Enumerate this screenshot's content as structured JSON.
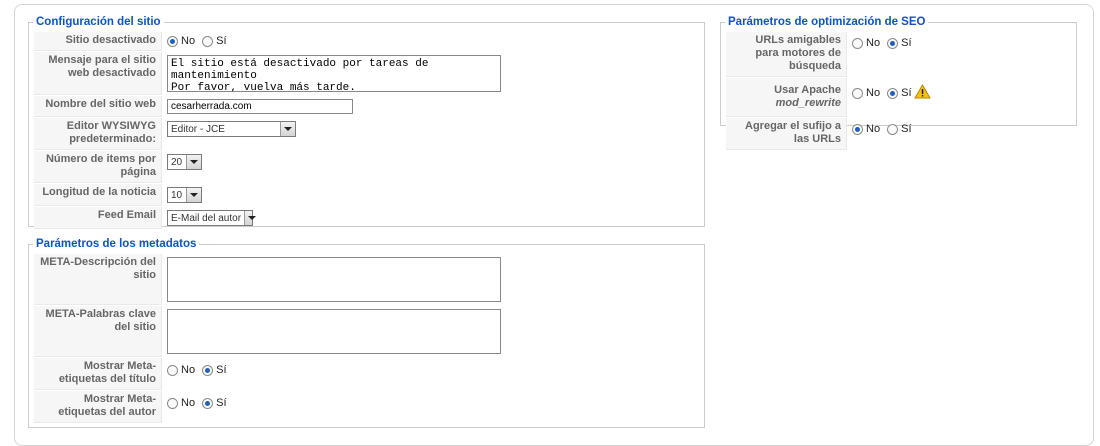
{
  "site": {
    "legend": "Configuración del sitio",
    "offline": {
      "label": "Sitio desactivado",
      "options": [
        "No",
        "Sí"
      ],
      "selected": "No"
    },
    "offline_message": {
      "label": "Mensaje para el sitio web desactivado",
      "value": "El sitio está desactivado por tareas de mantenimiento\nPor favor, vuelva más tarde."
    },
    "site_name": {
      "label": "Nombre del sitio web",
      "value": "cesarherrada.com"
    },
    "editor": {
      "label": "Editor WYSIWYG predeterminado:",
      "value": "Editor - JCE"
    },
    "list_limit": {
      "label": "Número de items por página",
      "value": "20"
    },
    "feed_limit": {
      "label": "Longitud de la noticia",
      "value": "10"
    },
    "feed_email": {
      "label": "Feed Email",
      "value": "E-Mail del autor"
    }
  },
  "metadata": {
    "legend": "Parámetros de los metadatos",
    "meta_desc": {
      "label": "META-Descripción del sitio",
      "value": ""
    },
    "meta_keys": {
      "label": "META-Palabras clave del sitio",
      "value": ""
    },
    "meta_title": {
      "label": "Mostrar Meta-etiquetas del título",
      "options": [
        "No",
        "Sí"
      ],
      "selected": "Sí"
    },
    "meta_author": {
      "label": "Mostrar Meta-etiquetas del autor",
      "options": [
        "No",
        "Sí"
      ],
      "selected": "Sí"
    }
  },
  "seo": {
    "legend": "Parámetros de optimización de SEO",
    "sef": {
      "label": "URLs amigables para motores de búsqueda",
      "options": [
        "No",
        "Sí"
      ],
      "selected": "Sí"
    },
    "rewrite": {
      "label_prefix": "Usar Apache ",
      "label_em": "mod_rewrite",
      "options": [
        "No",
        "Sí"
      ],
      "selected": "Sí",
      "icon": "warning-icon"
    },
    "suffix": {
      "label": "Agregar el sufijo a las URLs",
      "options": [
        "No",
        "Sí"
      ],
      "selected": "No"
    }
  },
  "colors": {
    "legend": "#0b55c4",
    "warning": "#f5c400"
  }
}
